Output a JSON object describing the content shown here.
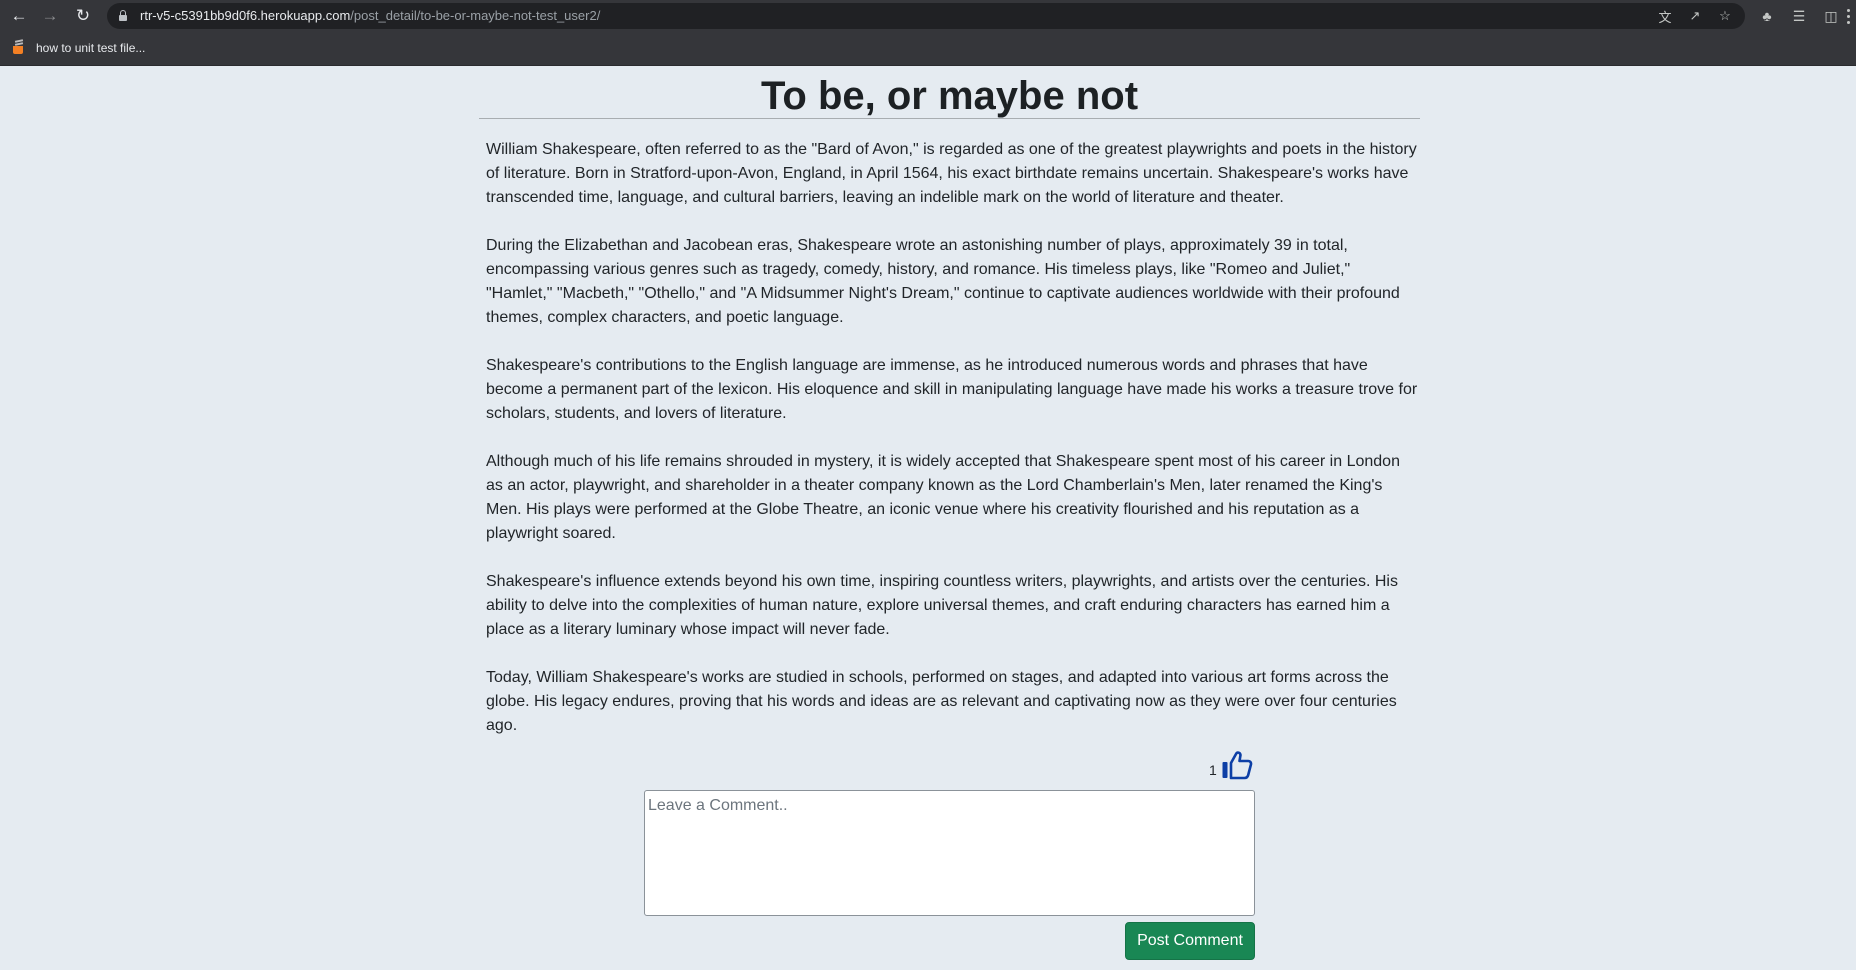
{
  "browser": {
    "url_host": "rtr-v5-c5391bb9d0f6.herokuapp.com",
    "url_path": "/post_detail/to-be-or-maybe-not-test_user2/",
    "bookmark_label": "how to unit test file..."
  },
  "post": {
    "title": "To be, or maybe not",
    "paragraphs": [
      "William Shakespeare, often referred to as the \"Bard of Avon,\" is regarded as one of the greatest playwrights and poets in the history of literature. Born in Stratford-upon-Avon, England, in April 1564, his exact birthdate remains uncertain. Shakespeare's works have transcended time, language, and cultural barriers, leaving an indelible mark on the world of literature and theater.",
      "During the Elizabethan and Jacobean eras, Shakespeare wrote an astonishing number of plays, approximately 39 in total, encompassing various genres such as tragedy, comedy, history, and romance. His timeless plays, like \"Romeo and Juliet,\" \"Hamlet,\" \"Macbeth,\" \"Othello,\" and \"A Midsummer Night's Dream,\" continue to captivate audiences worldwide with their profound themes, complex characters, and poetic language.",
      "Shakespeare's contributions to the English language are immense, as he introduced numerous words and phrases that have become a permanent part of the lexicon. His eloquence and skill in manipulating language have made his works a treasure trove for scholars, students, and lovers of literature.",
      "Although much of his life remains shrouded in mystery, it is widely accepted that Shakespeare spent most of his career in London as an actor, playwright, and shareholder in a theater company known as the Lord Chamberlain's Men, later renamed the King's Men. His plays were performed at the Globe Theatre, an iconic venue where his creativity flourished and his reputation as a playwright soared.",
      "Shakespeare's influence extends beyond his own time, inspiring countless writers, playwrights, and artists over the centuries. His ability to delve into the complexities of human nature, explore universal themes, and craft enduring characters has earned him a place as a literary luminary whose impact will never fade.",
      "Today, William Shakespeare's works are studied in schools, performed on stages, and adapted into various art forms across the globe. His legacy endures, proving that his words and ideas are as relevant and captivating now as they were over four centuries ago."
    ],
    "like_count": "1"
  },
  "comment_form": {
    "placeholder": "Leave a Comment..",
    "value": "",
    "submit_label": "Post Comment"
  },
  "colors": {
    "page_bg": "#e5ebf1",
    "like_icon": "#0d3fa6",
    "submit_button": "#198754"
  }
}
